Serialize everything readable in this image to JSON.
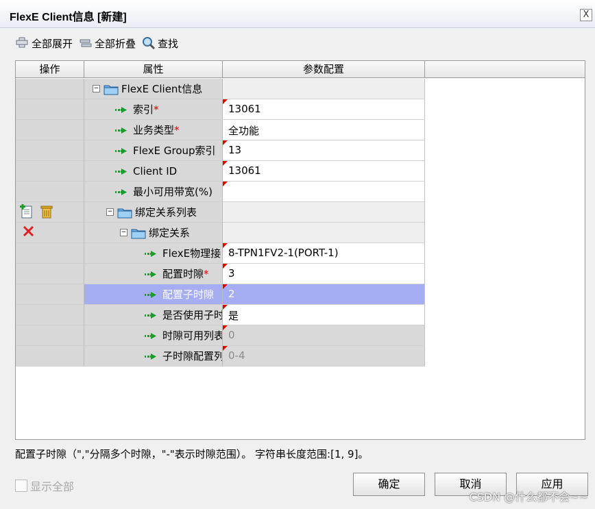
{
  "window": {
    "title": "FlexE Client信息 [新建]",
    "close_glyph": "X"
  },
  "toolbar": {
    "expand_all": "全部展开",
    "collapse_all": "全部折叠",
    "find": "查找"
  },
  "grid": {
    "headers": {
      "operation": "操作",
      "property": "属性",
      "config": "参数配置"
    },
    "rows": [
      {
        "label": "FlexE Client信息",
        "value": "",
        "type": "group",
        "toggle": "−"
      },
      {
        "label": "索引",
        "required": "*",
        "value": "13061",
        "type": "field"
      },
      {
        "label": "业务类型",
        "required": "*",
        "value": "全功能",
        "type": "field"
      },
      {
        "label": "FlexE Group索引",
        "value": "13",
        "type": "field"
      },
      {
        "label": "Client ID",
        "value": "13061",
        "type": "field"
      },
      {
        "label": "最小可用带宽(%)",
        "value": "",
        "type": "field"
      },
      {
        "label": "绑定关系列表",
        "value": "",
        "type": "group",
        "toggle": "−"
      },
      {
        "label": "绑定关系",
        "value": "",
        "type": "group",
        "toggle": "−"
      },
      {
        "label": "FlexE物理接口",
        "value": "8-TPN1FV2-1(PORT-1)",
        "type": "field"
      },
      {
        "label": "配置时隙",
        "required": "*",
        "value": "3",
        "type": "field"
      },
      {
        "label": "配置子时隙",
        "value": "2",
        "type": "field",
        "selected": true
      },
      {
        "label": "是否使用子时隙",
        "value": "是",
        "type": "field"
      },
      {
        "label": "时隙可用列表",
        "value": "0",
        "type": "field",
        "disabled": true
      },
      {
        "label": "子时隙配置列表",
        "value": "0-4",
        "type": "field",
        "disabled": true
      }
    ]
  },
  "description": "配置子时隙（\",\"分隔多个时隙，\"-\"表示时隙范围）。 字符串长度范围:[1, 9]。",
  "footer": {
    "show_all": "显示全部",
    "ok": "确定",
    "cancel": "取消",
    "apply": "应用",
    "watermark": "CSDN @什么都不会~~"
  }
}
